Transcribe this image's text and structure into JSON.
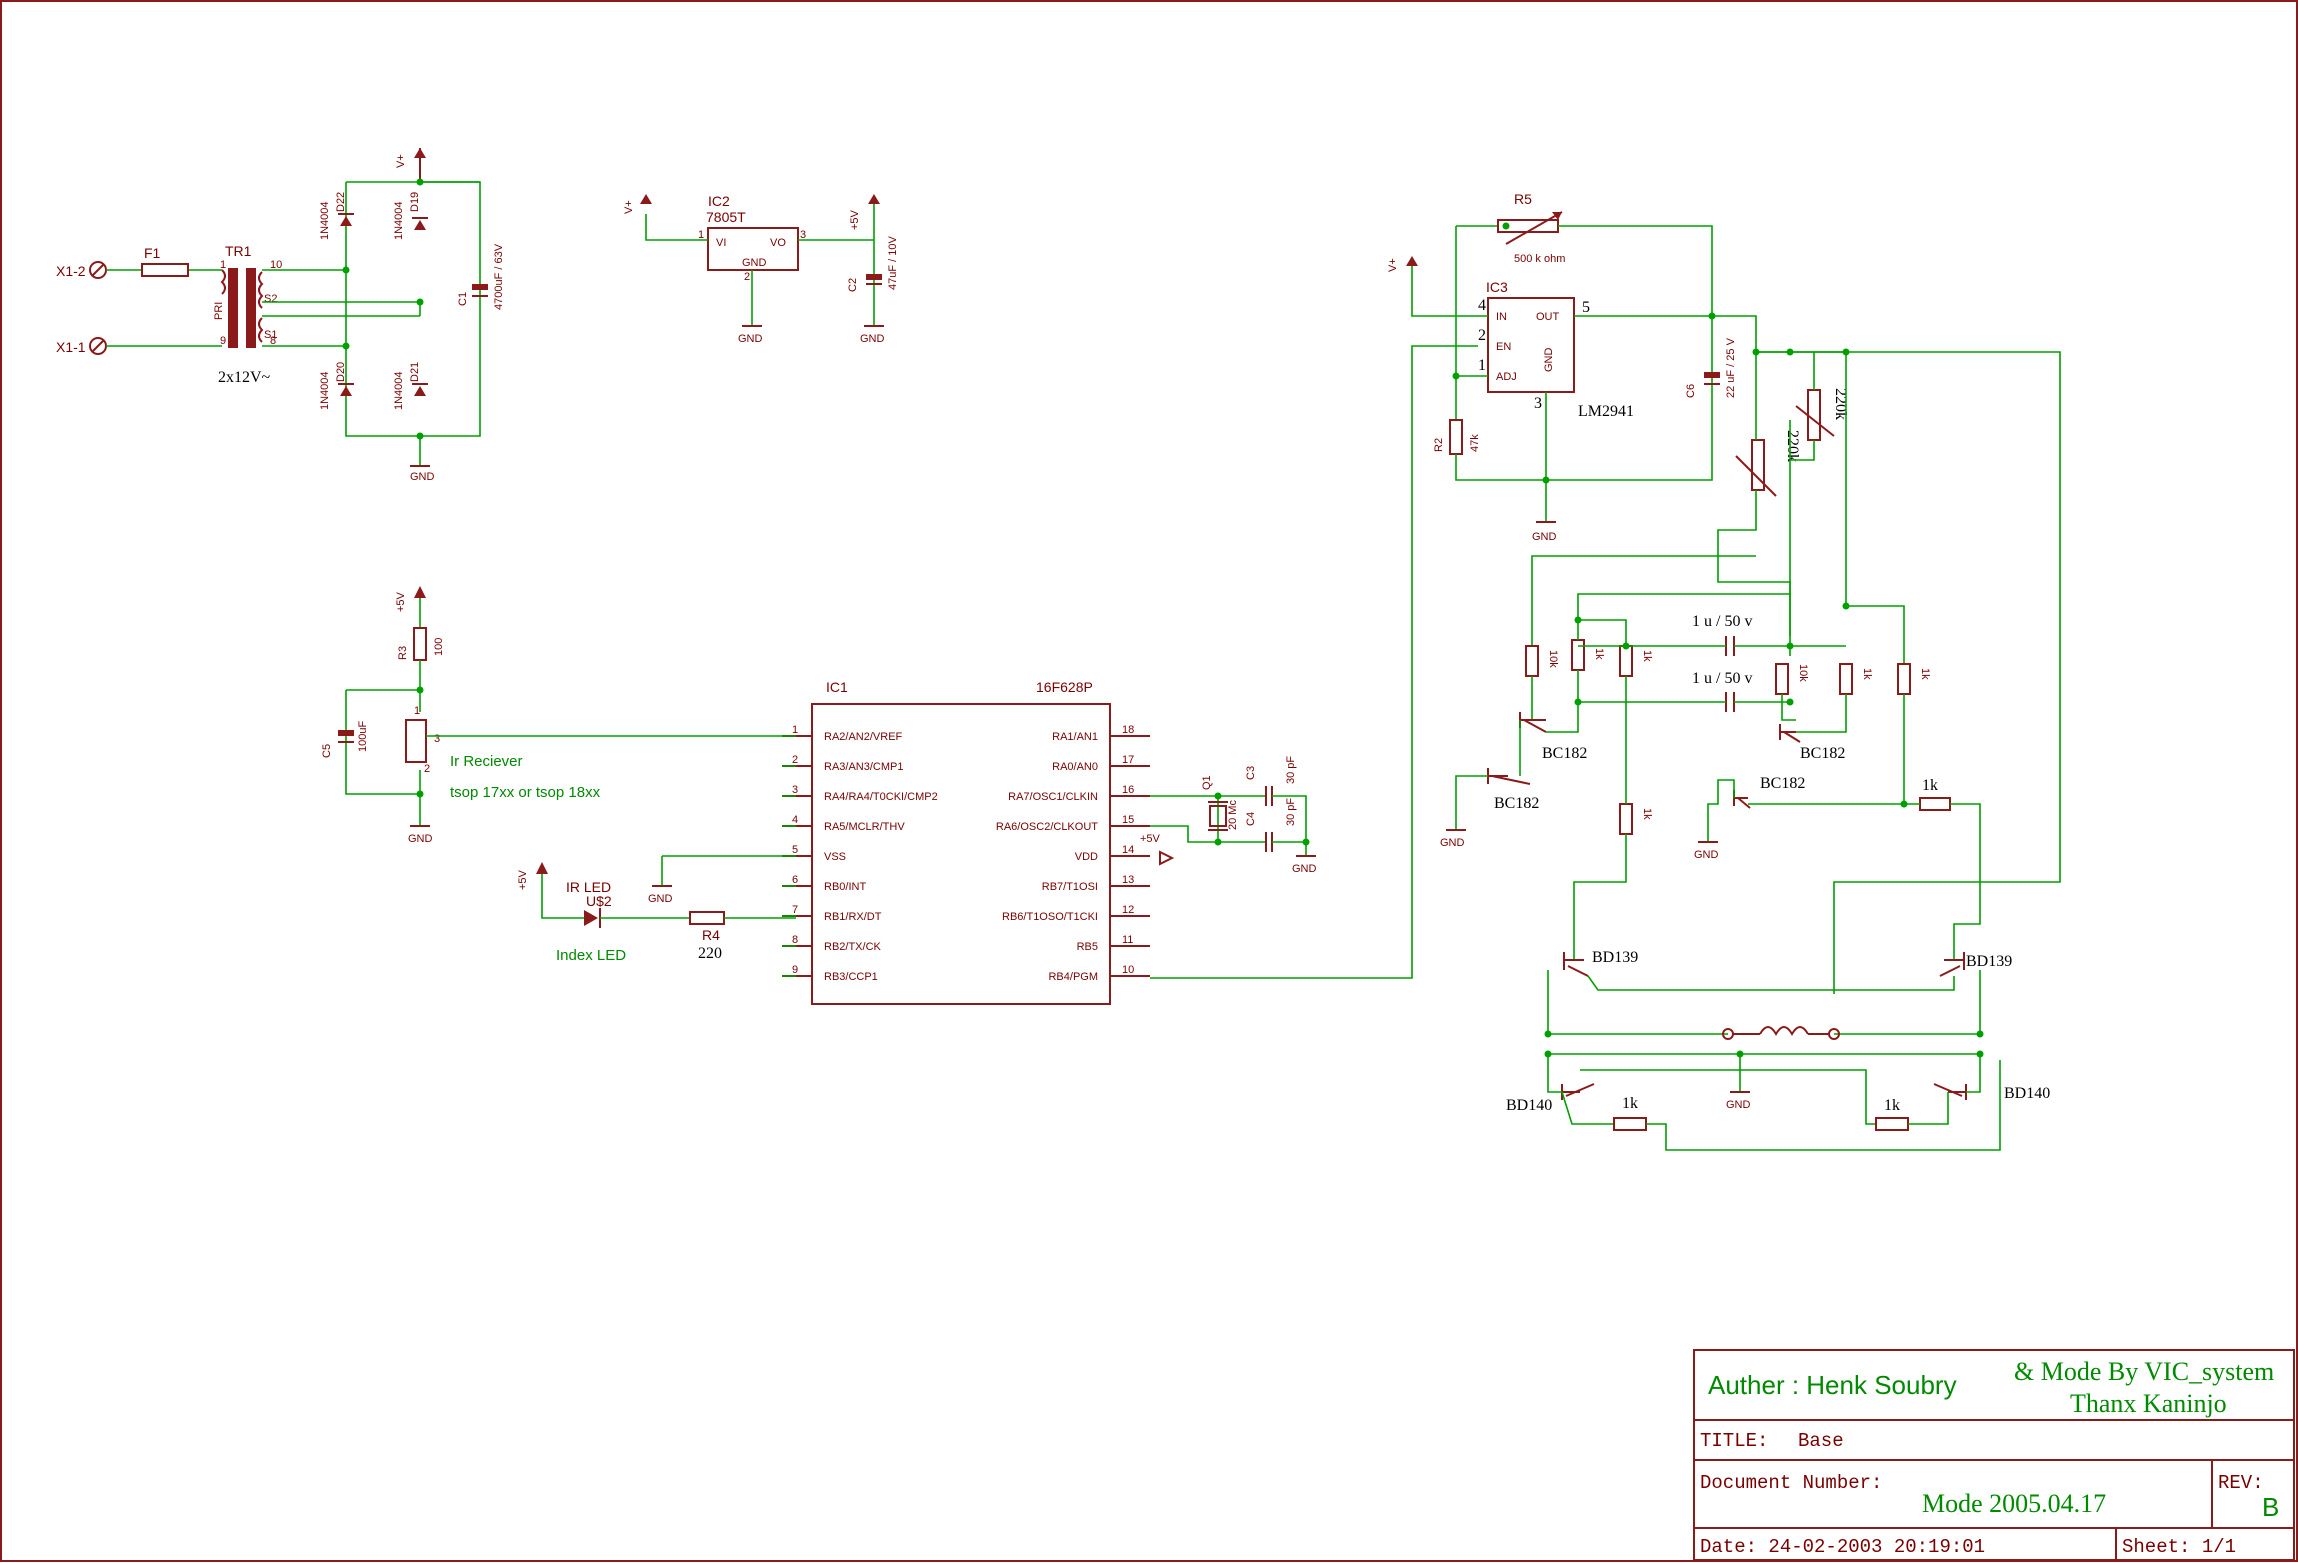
{
  "power_supply": {
    "connectors": [
      "X1-2",
      "X1-1"
    ],
    "fuse": "F1",
    "transformer": "TR1",
    "transformer_rating": "2x12V~",
    "tr_pins": [
      "1",
      "9",
      "10",
      "8",
      "PRI",
      "S2",
      "S1"
    ],
    "diodes": [
      "D22",
      "D19",
      "D20",
      "D21"
    ],
    "diode_type": "1N4004",
    "c1": "C1",
    "c1_value": "4700uF / 63V",
    "vplus": "V+",
    "gnd": "GND"
  },
  "regulator": {
    "ref": "IC2",
    "part": "7805T",
    "pins": {
      "vi": "VI",
      "vo": "VO",
      "gnd": "GND"
    },
    "pin_nums": [
      "1",
      "3",
      "2"
    ],
    "vplus": "V+",
    "plus5v": "+5V",
    "c2": "C2",
    "c2_value": "47uF / 10V",
    "gnd": "GND"
  },
  "ir_receiver": {
    "r3": "R3",
    "r3_value": "100",
    "c5": "C5",
    "c5_value": "100uF",
    "label": "Ir Reciever",
    "note": "tsop 17xx or tsop 18xx",
    "pin_nums": [
      "1",
      "3",
      "2"
    ],
    "plus5v": "+5V",
    "gnd": "GND"
  },
  "led": {
    "ref": "U$2",
    "type": "IR LED",
    "label": "Index LED",
    "r4": "R4",
    "r4_value": "220",
    "plus5v": "+5V",
    "gnd": "GND"
  },
  "mcu": {
    "ref": "IC1",
    "part": "16F628P",
    "left_pins": [
      {
        "n": "1",
        "name": "RA2/AN2/VREF"
      },
      {
        "n": "2",
        "name": "RA3/AN3/CMP1"
      },
      {
        "n": "3",
        "name": "RA4/RA4/T0CKI/CMP2"
      },
      {
        "n": "4",
        "name": "RA5/MCLR/THV"
      },
      {
        "n": "5",
        "name": "VSS"
      },
      {
        "n": "6",
        "name": "RB0/INT"
      },
      {
        "n": "7",
        "name": "RB1/RX/DT"
      },
      {
        "n": "8",
        "name": "RB2/TX/CK"
      },
      {
        "n": "9",
        "name": "RB3/CCP1"
      }
    ],
    "right_pins": [
      {
        "n": "18",
        "name": "RA1/AN1"
      },
      {
        "n": "17",
        "name": "RA0/AN0"
      },
      {
        "n": "16",
        "name": "RA7/OSC1/CLKIN"
      },
      {
        "n": "15",
        "name": "RA6/OSC2/CLKOUT"
      },
      {
        "n": "14",
        "name": "VDD"
      },
      {
        "n": "13",
        "name": "RB7/T1OSI"
      },
      {
        "n": "12",
        "name": "RB6/T1OSO/T1CKI"
      },
      {
        "n": "11",
        "name": "RB5"
      },
      {
        "n": "10",
        "name": "RB4/PGM"
      }
    ],
    "plus5v": "+5V"
  },
  "crystal": {
    "q1": "Q1",
    "q1_value": "20 Mc",
    "c3": "C3",
    "c3_value": "30 pF",
    "c4": "C4",
    "c4_value": "30 pF",
    "gnd": "GND"
  },
  "regulator2": {
    "ref": "IC3",
    "part": "LM2941",
    "pins": {
      "in": "IN",
      "en": "EN",
      "adj": "ADJ",
      "out": "OUT",
      "gnd": "GND"
    },
    "pin_nums": [
      "4",
      "2",
      "1",
      "5",
      "3"
    ],
    "r5": "R5",
    "r5_value": "500 k ohm",
    "r2": "R2",
    "r2_value": "47k",
    "c6": "C6",
    "c6_value": "22 uF / 25 V",
    "vplus": "V+",
    "gnd": "GND"
  },
  "driver": {
    "pot_value": "220k",
    "r10k": "10k",
    "r1k": "1k",
    "cap": "1 u / 50 v",
    "bc182": "BC182",
    "bd139": "BD139",
    "bd140": "BD140",
    "gnd": "GND"
  },
  "title_block": {
    "author": "Auther : Henk Soubry",
    "mod_by": "& Mode By VIC_system",
    "thanks": "Thanx Kaninjo",
    "title_label": "TITLE:",
    "title_value": "Base",
    "doc_label": "Document Number:",
    "doc_value": "Mode 2005.04.17",
    "rev_label": "REV:",
    "rev_value": "B",
    "date": "Date: 24-02-2003 20:19:01",
    "sheet": "Sheet: 1/1"
  },
  "colors": {
    "component": "#8b1a1a",
    "wire": "#00a000",
    "text_green": "#008a00"
  }
}
